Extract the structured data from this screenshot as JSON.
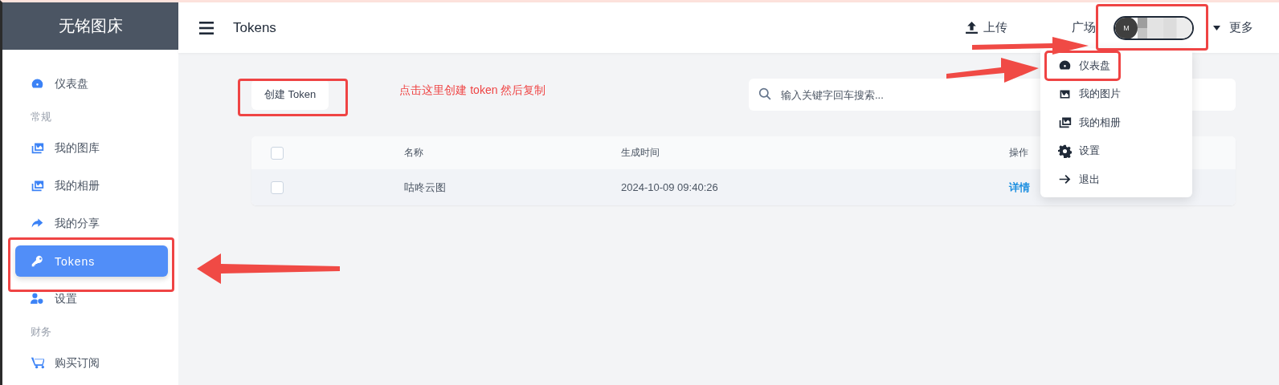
{
  "sidebar": {
    "brand": "无铭图床",
    "items": [
      {
        "kind": "link",
        "label": "仪表盘",
        "selected": false
      },
      {
        "kind": "heading",
        "label": "常规"
      },
      {
        "kind": "link",
        "label": "我的图库",
        "selected": false
      },
      {
        "kind": "link",
        "label": "我的相册",
        "selected": false
      },
      {
        "kind": "link",
        "label": "我的分享",
        "selected": false
      },
      {
        "kind": "link",
        "label": "Tokens",
        "selected": true
      },
      {
        "kind": "link",
        "label": "设置",
        "selected": false
      },
      {
        "kind": "heading",
        "label": "财务"
      },
      {
        "kind": "link",
        "label": "购买订阅",
        "selected": false
      }
    ]
  },
  "header": {
    "title": "Tokens",
    "upload": "上传",
    "square": "广场",
    "avatar_initial": "M",
    "more": "更多"
  },
  "user_menu": {
    "items": [
      {
        "label": "仪表盘",
        "highlighted": true
      },
      {
        "label": "我的图片",
        "highlighted": false
      },
      {
        "label": "我的相册",
        "highlighted": false
      },
      {
        "label": "设置",
        "highlighted": false
      },
      {
        "label": "退出",
        "highlighted": false
      }
    ]
  },
  "toolbar": {
    "create_button": "创建 Token",
    "search": {
      "placeholder": "输入关键字回车搜索..."
    }
  },
  "annotation_note": "点击这里创建 token 然后复制",
  "table": {
    "columns": [
      "名称",
      "生成时间",
      "操作"
    ],
    "header_checked": false,
    "rows": [
      {
        "checked": false,
        "name": "咕咚云图",
        "created": "2024-10-09 09:40:26",
        "action": "详情"
      }
    ]
  }
}
